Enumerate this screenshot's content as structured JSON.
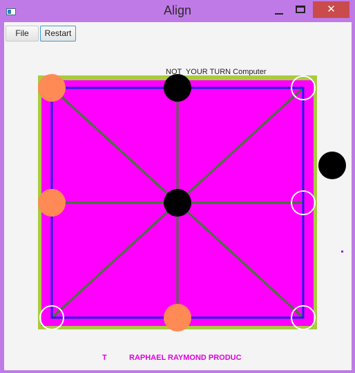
{
  "window": {
    "title": "Align",
    "close_glyph": "✕"
  },
  "menu": {
    "file_label": "File",
    "restart_label": "Restart"
  },
  "game": {
    "status_text": "NOT  YOUR TURN Computer",
    "footer_left": "T",
    "footer_credit": "RAPHAEL RAYMOND PRODUC"
  },
  "colors": {
    "window_frame": "#c07ae8",
    "board_fill": "#ff00ff",
    "board_border": "#a9cc3f",
    "grid_blue": "#1e1ee8",
    "diagonal_green": "#3d7a32",
    "player_piece": "#ff8a55",
    "computer_piece": "#000000",
    "empty_spot": "#ffffff",
    "footer_text": "#e000e0"
  },
  "pieces": [
    {
      "spot": "top-left",
      "owner": "player"
    },
    {
      "spot": "top-center",
      "owner": "computer"
    },
    {
      "spot": "top-right",
      "owner": "empty"
    },
    {
      "spot": "middle-left",
      "owner": "player"
    },
    {
      "spot": "center",
      "owner": "computer"
    },
    {
      "spot": "middle-right",
      "owner": "empty"
    },
    {
      "spot": "bottom-left",
      "owner": "empty"
    },
    {
      "spot": "bottom-center",
      "owner": "player"
    },
    {
      "spot": "bottom-right",
      "owner": "empty"
    },
    {
      "spot": "reserve",
      "owner": "computer"
    }
  ]
}
